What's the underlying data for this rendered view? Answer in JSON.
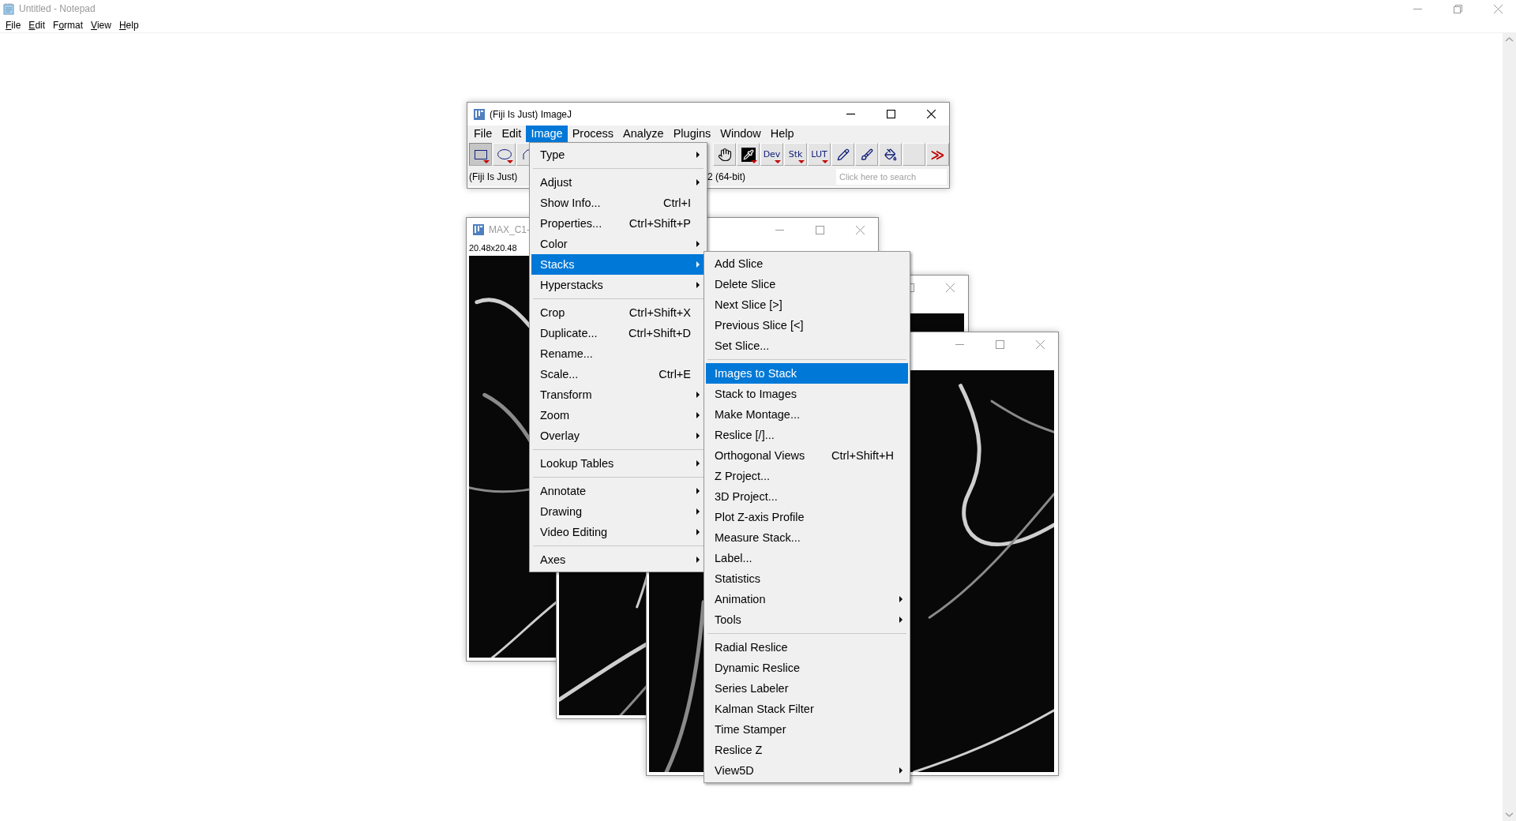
{
  "notepad": {
    "title": "Untitled - Notepad",
    "menu": [
      {
        "key": "F",
        "rest": "ile"
      },
      {
        "key": "E",
        "rest": "dit"
      },
      {
        "lead": "F",
        "key": "o",
        "rest": "rmat"
      },
      {
        "key": "V",
        "rest": "iew"
      },
      {
        "key": "H",
        "rest": "elp"
      }
    ]
  },
  "imagej": {
    "title": "(Fiji Is Just) ImageJ",
    "menu": [
      {
        "label": "File",
        "selected": false
      },
      {
        "label": "Edit",
        "selected": false
      },
      {
        "label": "Image",
        "selected": true
      },
      {
        "label": "Process",
        "selected": false
      },
      {
        "label": "Analyze",
        "selected": false
      },
      {
        "label": "Plugins",
        "selected": false
      },
      {
        "label": "Window",
        "selected": false
      },
      {
        "label": "Help",
        "selected": false
      }
    ],
    "tools_left": [
      {
        "kind": "rectangle",
        "selected": true,
        "dropdown": true
      },
      {
        "kind": "oval",
        "selected": false,
        "dropdown": true
      },
      {
        "kind": "polygon",
        "selected": false
      }
    ],
    "tools_right": [
      {
        "kind": "hand",
        "dropdown": false
      },
      {
        "kind": "dropper",
        "dropdown": true
      },
      {
        "kind": "text",
        "label": "Dev",
        "dropdown": true
      },
      {
        "kind": "text",
        "label": "Stk",
        "dropdown": true
      },
      {
        "kind": "text",
        "label": "LUT",
        "dropdown": true
      },
      {
        "kind": "pencil",
        "dropdown": false
      },
      {
        "kind": "brush",
        "dropdown": false
      },
      {
        "kind": "fill",
        "dropdown": false
      },
      {
        "kind": "blank",
        "dropdown": false
      },
      {
        "kind": "more",
        "label": "≫",
        "dropdown": false
      }
    ],
    "status_left": "(Fiji Is Just)",
    "status_right": "2 (64-bit)",
    "search": {
      "placeholder": "Click here to search"
    }
  },
  "image_windows": [
    {
      "title": "MAX_C1-",
      "info": "20.48x20.48",
      "kind": "picture"
    },
    {
      "kind": "picture"
    },
    {
      "kind": "picture"
    }
  ],
  "image_menu": {
    "items": [
      {
        "kind": "submenu",
        "label": "Type",
        "selected": false
      },
      {
        "kind": "separator"
      },
      {
        "kind": "submenu",
        "label": "Adjust",
        "selected": false
      },
      {
        "kind": "item",
        "label": "Show Info...",
        "shortcut": "Ctrl+I",
        "selected": false
      },
      {
        "kind": "item",
        "label": "Properties...",
        "shortcut": "Ctrl+Shift+P",
        "selected": false
      },
      {
        "kind": "submenu",
        "label": "Color",
        "selected": false
      },
      {
        "kind": "submenu",
        "label": "Stacks",
        "selected": true
      },
      {
        "kind": "submenu",
        "label": "Hyperstacks",
        "selected": false
      },
      {
        "kind": "separator"
      },
      {
        "kind": "item",
        "label": "Crop",
        "shortcut": "Ctrl+Shift+X",
        "selected": false
      },
      {
        "kind": "item",
        "label": "Duplicate...",
        "shortcut": "Ctrl+Shift+D",
        "selected": false
      },
      {
        "kind": "item",
        "label": "Rename...",
        "selected": false
      },
      {
        "kind": "item",
        "label": "Scale...",
        "shortcut": "Ctrl+E",
        "selected": false
      },
      {
        "kind": "submenu",
        "label": "Transform",
        "selected": false
      },
      {
        "kind": "submenu",
        "label": "Zoom",
        "selected": false
      },
      {
        "kind": "submenu",
        "label": "Overlay",
        "selected": false
      },
      {
        "kind": "separator"
      },
      {
        "kind": "submenu",
        "label": "Lookup Tables",
        "selected": false
      },
      {
        "kind": "separator"
      },
      {
        "kind": "submenu",
        "label": "Annotate",
        "selected": false
      },
      {
        "kind": "submenu",
        "label": "Drawing",
        "selected": false
      },
      {
        "kind": "submenu",
        "label": "Video Editing",
        "selected": false
      },
      {
        "kind": "separator"
      },
      {
        "kind": "submenu",
        "label": "Axes",
        "selected": false
      }
    ]
  },
  "stacks_menu": {
    "items": [
      {
        "kind": "item",
        "label": "Add Slice",
        "selected": false
      },
      {
        "kind": "item",
        "label": "Delete Slice",
        "selected": false
      },
      {
        "kind": "item",
        "label": "Next Slice [>]",
        "selected": false
      },
      {
        "kind": "item",
        "label": "Previous Slice [<]",
        "selected": false
      },
      {
        "kind": "item",
        "label": "Set Slice...",
        "selected": false
      },
      {
        "kind": "separator"
      },
      {
        "kind": "item",
        "label": "Images to Stack",
        "selected": true
      },
      {
        "kind": "item",
        "label": "Stack to Images",
        "selected": false
      },
      {
        "kind": "item",
        "label": "Make Montage...",
        "selected": false
      },
      {
        "kind": "item",
        "label": "Reslice [/]...",
        "selected": false
      },
      {
        "kind": "item",
        "label": "Orthogonal Views",
        "shortcut": "Ctrl+Shift+H",
        "selected": false
      },
      {
        "kind": "item",
        "label": "Z Project...",
        "selected": false
      },
      {
        "kind": "item",
        "label": "3D Project...",
        "selected": false
      },
      {
        "kind": "item",
        "label": "Plot Z-axis Profile",
        "selected": false
      },
      {
        "kind": "item",
        "label": "Measure Stack...",
        "selected": false
      },
      {
        "kind": "item",
        "label": "Label...",
        "selected": false
      },
      {
        "kind": "item",
        "label": "Statistics",
        "selected": false
      },
      {
        "kind": "submenu",
        "label": "Animation",
        "selected": false
      },
      {
        "kind": "submenu",
        "label": "Tools",
        "selected": false
      },
      {
        "kind": "separator"
      },
      {
        "kind": "item",
        "label": "Radial Reslice",
        "selected": false
      },
      {
        "kind": "item",
        "label": "Dynamic Reslice",
        "selected": false
      },
      {
        "kind": "item",
        "label": "Series Labeler",
        "selected": false
      },
      {
        "kind": "item",
        "label": "Kalman Stack Filter",
        "selected": false
      },
      {
        "kind": "item",
        "label": "Time Stamper",
        "selected": false
      },
      {
        "kind": "item",
        "label": "Reslice Z",
        "selected": false
      },
      {
        "kind": "submenu",
        "label": "View5D",
        "selected": false
      }
    ]
  }
}
